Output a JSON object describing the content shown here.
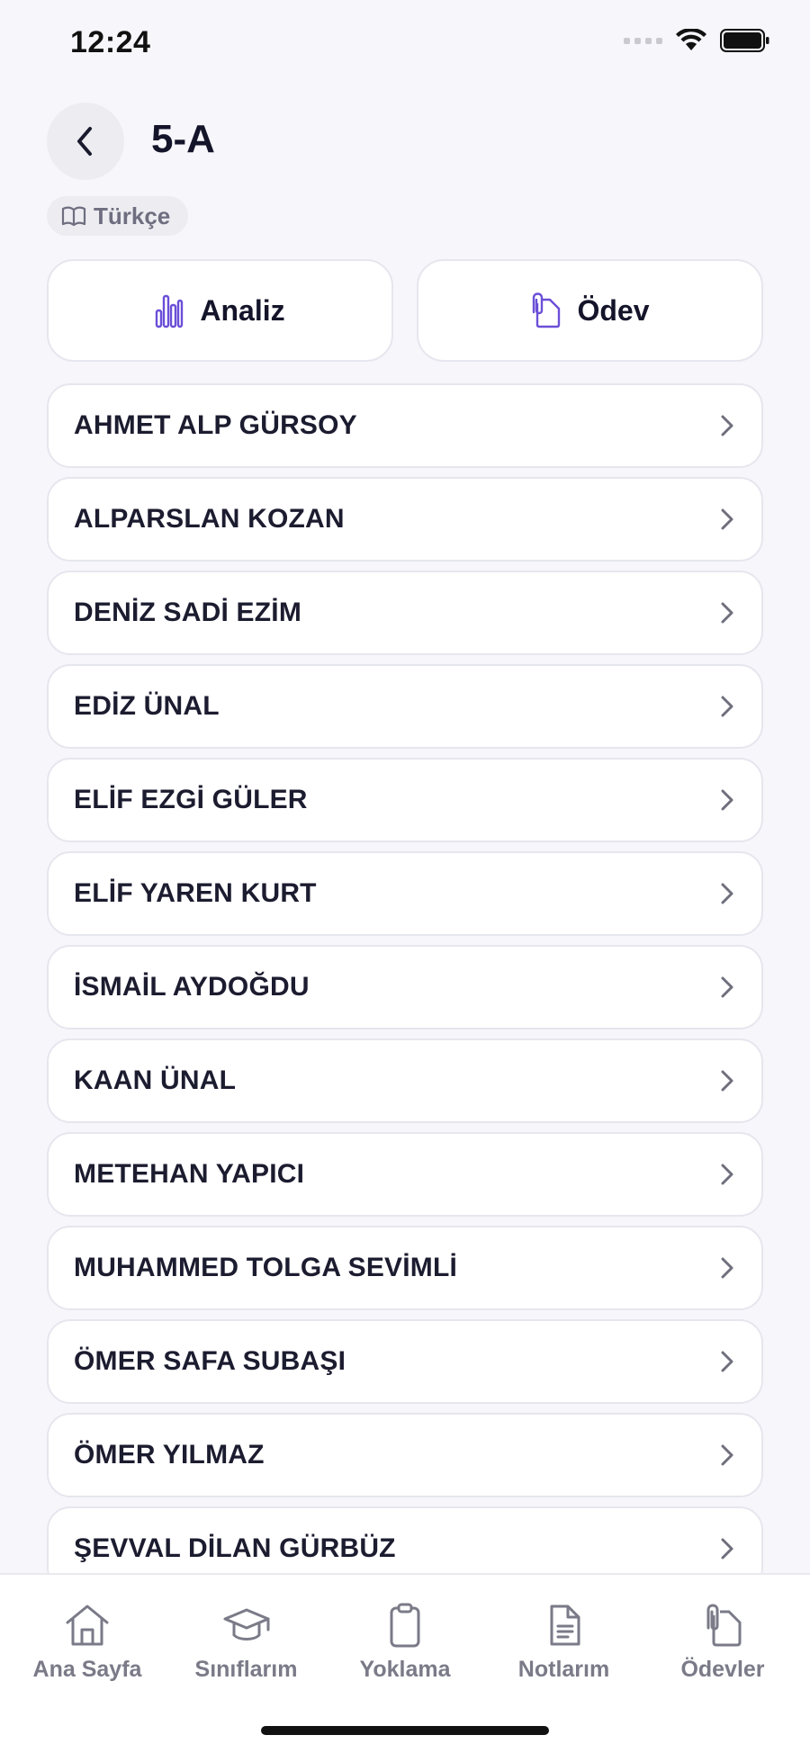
{
  "status_bar": {
    "time": "12:24"
  },
  "header": {
    "title": "5-A",
    "subject": "Türkçe"
  },
  "actions": [
    {
      "label": "Analiz",
      "icon": "bar-chart-icon"
    },
    {
      "label": "Ödev",
      "icon": "clip-document-icon"
    }
  ],
  "students": [
    "AHMET ALP GÜRSOY",
    "ALPARSLAN KOZAN",
    "DENİZ SADİ EZİM",
    "EDİZ ÜNAL",
    "ELİF EZGİ GÜLER",
    "ELİF YAREN KURT",
    "İSMAİL AYDOĞDU",
    "KAAN ÜNAL",
    "METEHAN YAPICI",
    "MUHAMMED TOLGA SEVİMLİ",
    "ÖMER SAFA SUBAŞI",
    "ÖMER YILMAZ",
    "ŞEVVAL DİLAN GÜRBÜZ"
  ],
  "tabbar": [
    {
      "label": "Ana Sayfa",
      "icon": "home-icon"
    },
    {
      "label": "Sınıflarım",
      "icon": "graduation-cap-icon"
    },
    {
      "label": "Yoklama",
      "icon": "clipboard-icon"
    },
    {
      "label": "Notlarım",
      "icon": "document-icon"
    },
    {
      "label": "Ödevler",
      "icon": "clip-document-icon"
    }
  ],
  "colors": {
    "accent": "#6b4fd8",
    "background": "#f6f6fb",
    "tab_inactive": "#7a7a88"
  }
}
